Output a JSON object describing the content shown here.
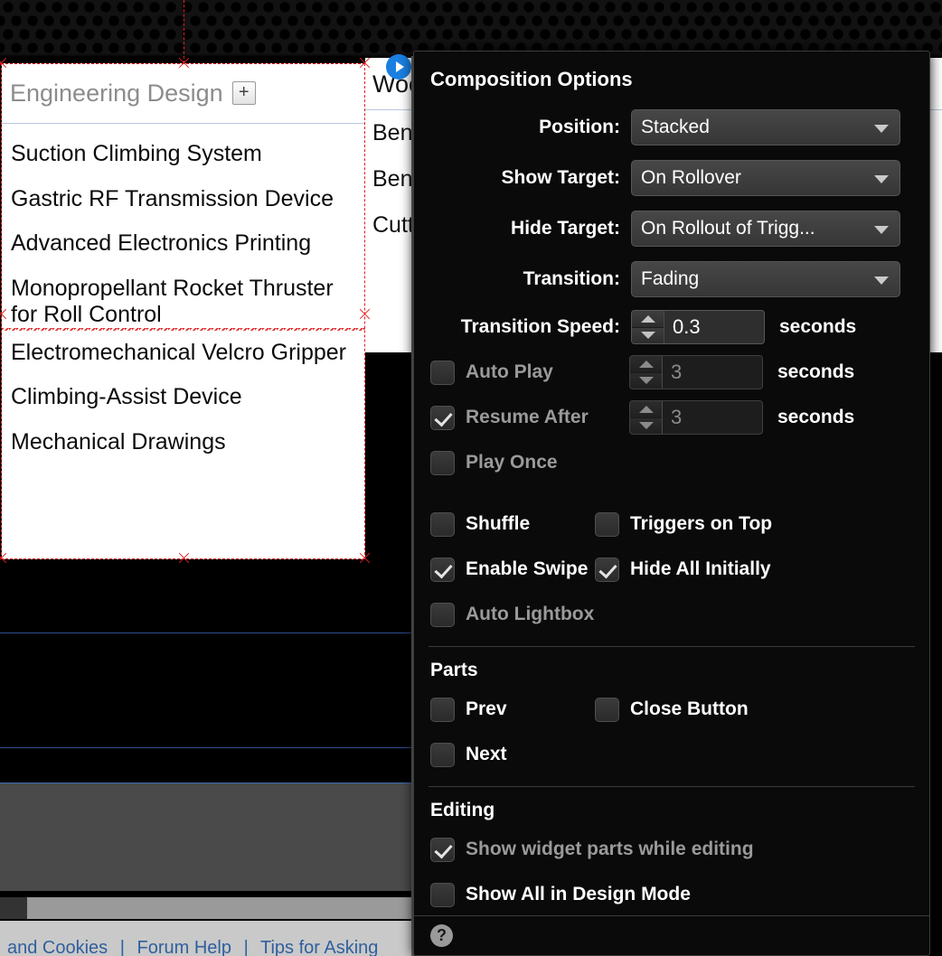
{
  "panel": {
    "title": "Composition Options",
    "fields": [
      {
        "label": "Position:",
        "value": "Stacked"
      },
      {
        "label": "Show Target:",
        "value": "On Rollover"
      },
      {
        "label": "Hide Target:",
        "value": "On Rollout of Trigg..."
      },
      {
        "label": "Transition:",
        "value": "Fading"
      }
    ],
    "transition_speed": {
      "label": "Transition Speed:",
      "value": "0.3",
      "unit": "seconds"
    },
    "auto_play": {
      "label": "Auto Play",
      "checked": false,
      "value": "3",
      "unit": "seconds"
    },
    "resume_after": {
      "label": "Resume After",
      "checked": true,
      "value": "3",
      "unit": "seconds"
    },
    "play_once": {
      "label": "Play Once",
      "checked": false
    },
    "shuffle": {
      "label": "Shuffle",
      "checked": false
    },
    "triggers_on_top": {
      "label": "Triggers on Top",
      "checked": false
    },
    "enable_swipe": {
      "label": "Enable Swipe",
      "checked": true
    },
    "hide_all_initially": {
      "label": "Hide All Initially",
      "checked": true
    },
    "auto_lightbox": {
      "label": "Auto Lightbox",
      "checked": false
    },
    "parts": {
      "heading": "Parts",
      "prev": {
        "label": "Prev",
        "checked": false
      },
      "close_button": {
        "label": "Close Button",
        "checked": false
      },
      "next": {
        "label": "Next",
        "checked": false
      }
    },
    "editing": {
      "heading": "Editing",
      "show_widget_parts": {
        "label": "Show widget parts while editing",
        "checked": true
      },
      "show_all_design_mode": {
        "label": "Show All in Design Mode",
        "checked": false
      }
    },
    "help_icon": "question-mark-icon"
  },
  "front_panel": {
    "header_title": "Engineering Design",
    "add_button": "+",
    "items": [
      "Suction Climbing System",
      "Gastric RF Transmission Device",
      "Advanced Electronics Printing",
      "Monopropellant Rocket Thruster for Roll Control",
      "Electromechanical Velcro Gripper",
      "Climbing-Assist Device",
      "Mechanical Drawings"
    ]
  },
  "back_panel": {
    "header_title": "Woodworking",
    "items": [
      "Bench",
      "Bench",
      "Cutting Board"
    ]
  },
  "bottom_links": {
    "items": [
      "and Cookies",
      "Forum Help",
      "Tips for Asking"
    ],
    "separator": "|"
  },
  "colors": {
    "panel_bg": "#0a0a0a",
    "accent_blue": "#1a7fe0",
    "selection_red": "#e02020",
    "link_blue": "#2f5f9e"
  }
}
